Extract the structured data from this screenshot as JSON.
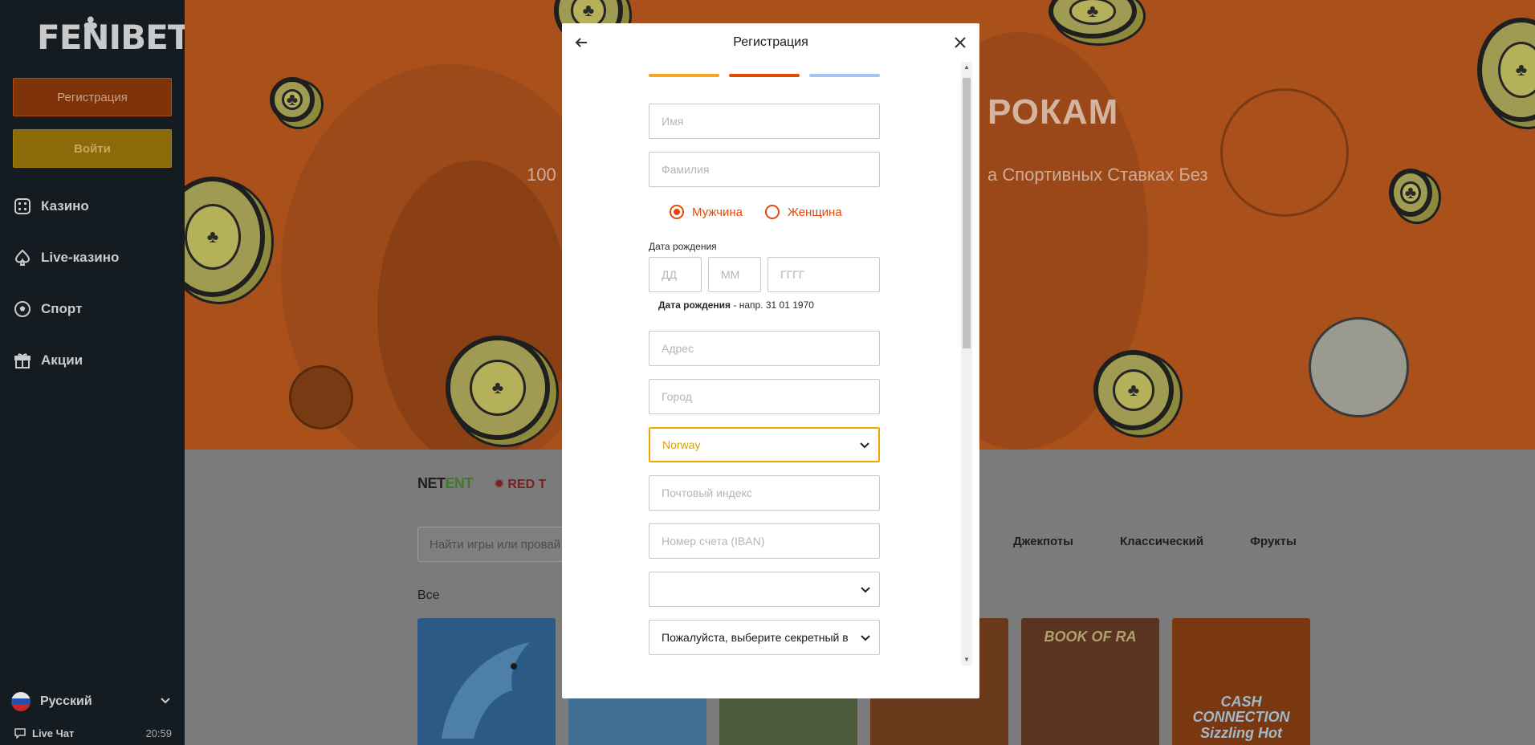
{
  "sidebar": {
    "logo": "FENIBET",
    "register_label": "Регистрация",
    "login_label": "Войти",
    "nav": [
      {
        "label": "Казино",
        "icon": "dice-icon"
      },
      {
        "label": "Live-казино",
        "icon": "spade-icon"
      },
      {
        "label": "Спорт",
        "icon": "soccer-ball-icon"
      },
      {
        "label": "Акции",
        "icon": "gift-icon"
      }
    ],
    "language": "Русский",
    "live_chat": "Live Чат",
    "clock": "20:59"
  },
  "hero": {
    "title_fragment": "РОКАМ",
    "subtitle_left": "100",
    "subtitle_right": "а Спортивных Ставках Без"
  },
  "providers": [
    {
      "name_a": "NET",
      "name_b": "ENT"
    },
    {
      "name": "RED T"
    }
  ],
  "games": {
    "search_placeholder": "Найти игры или провай",
    "categories": [
      "Джекпоты",
      "Классический",
      "Фрукты"
    ],
    "section_title": "Все",
    "tiles": [
      {
        "label": "",
        "color": "#2e5c88"
      },
      {
        "label": "",
        "color": "#3f6d8f"
      },
      {
        "label": "",
        "color": "#4a5a3c"
      },
      {
        "label": "",
        "color": "#6a3b1e"
      },
      {
        "label": "BOOK OF RA",
        "color": "#5b3420"
      },
      {
        "label": "CASH CONNECTION Sizzling Hot",
        "color": "#7a3a10"
      }
    ]
  },
  "modal": {
    "title": "Регистрация",
    "steps_colors": [
      "#f5a623",
      "#e24a08",
      "#a8c3f0"
    ],
    "first_name_placeholder": "Имя",
    "last_name_placeholder": "Фамилия",
    "gender_male": "Мужчина",
    "gender_female": "Женщина",
    "dob_label": "Дата рождения",
    "dob_day": "ДД",
    "dob_month": "ММ",
    "dob_year": "ГГГГ",
    "dob_hint_bold": "Дата рождения",
    "dob_hint_rest": " - напр. 31 01 1970",
    "address_placeholder": "Адрес",
    "city_placeholder": "Город",
    "country_value": "Norway",
    "postal_placeholder": "Почтовый индекс",
    "iban_placeholder": "Номер счета (IBAN)",
    "empty_select_value": "",
    "secret_question_value": "Пожалуйста, выберите секретный в"
  },
  "colors": {
    "accent_orange": "#e24a08",
    "accent_yellow": "#f0a800",
    "sidebar_bg": "#141b21"
  }
}
